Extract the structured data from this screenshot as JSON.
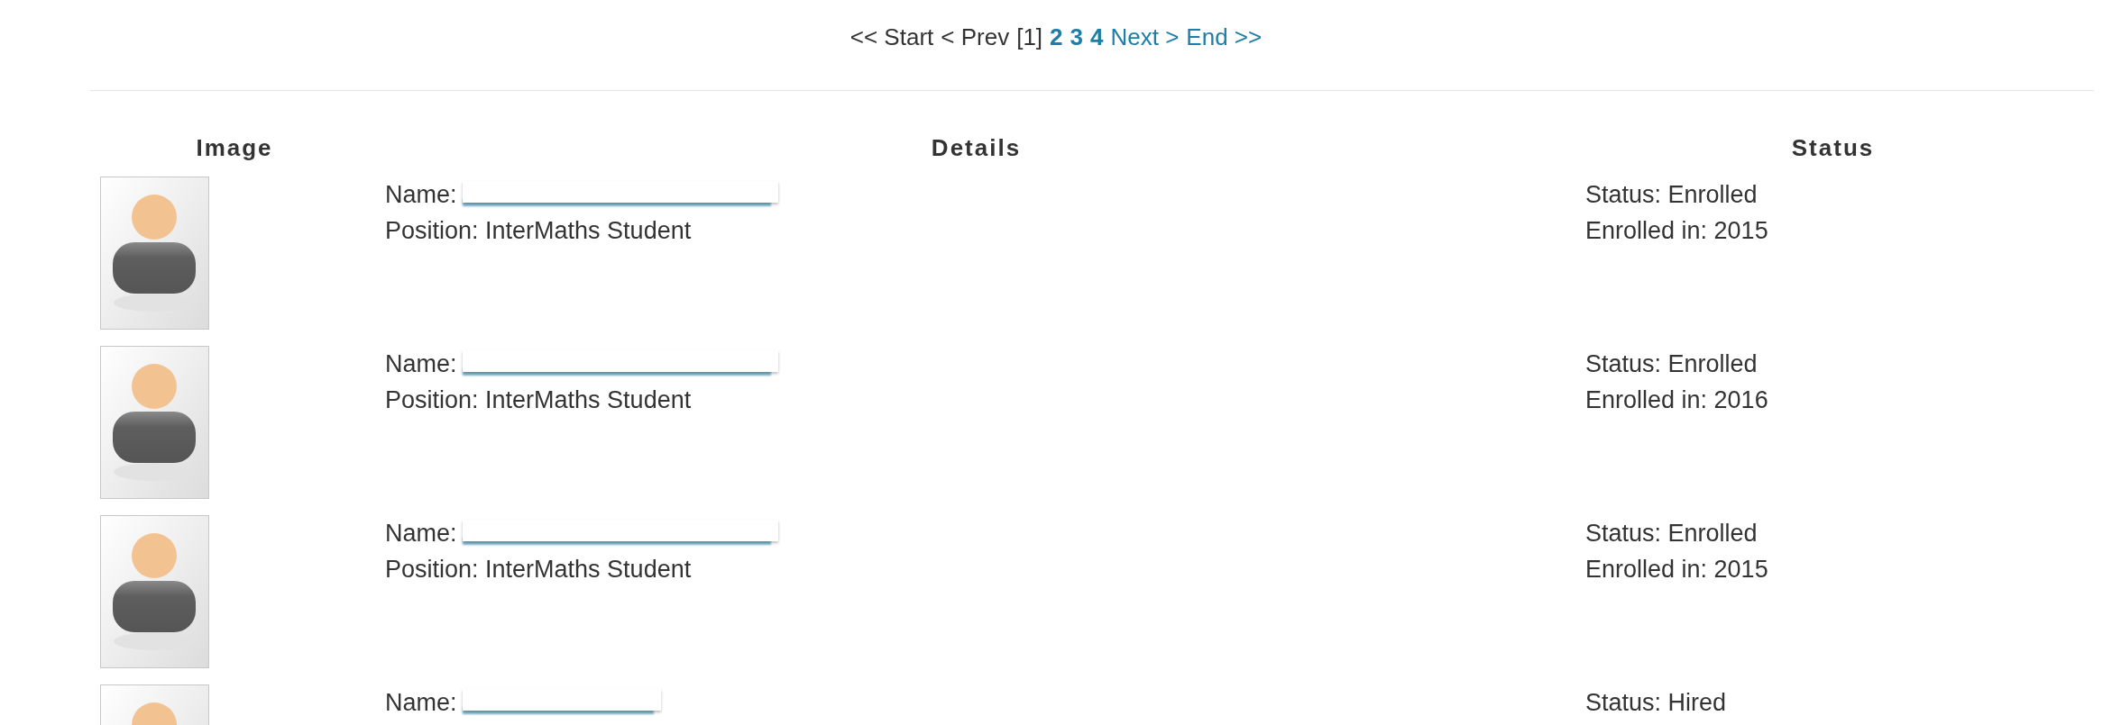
{
  "pagination": [
    {
      "label": "<< Start",
      "kind": "text"
    },
    {
      "label": "< Prev",
      "kind": "text"
    },
    {
      "label": "[1]",
      "kind": "page",
      "selected": true
    },
    {
      "label": "2",
      "kind": "page",
      "selected": false
    },
    {
      "label": "3",
      "kind": "page",
      "selected": false
    },
    {
      "label": "4",
      "kind": "page",
      "selected": false
    },
    {
      "label": "Next >",
      "kind": "link"
    },
    {
      "label": "End >>",
      "kind": "link"
    }
  ],
  "table": {
    "columns": [
      "Image",
      "Details",
      "Status"
    ],
    "rows": [
      {
        "name_label": "Name:",
        "position": "Position: InterMaths Student",
        "status": "Status: Enrolled",
        "enrolled": "Enrolled in: 2015"
      },
      {
        "name_label": "Name:",
        "position": "Position: InterMaths Student",
        "status": "Status: Enrolled",
        "enrolled": "Enrolled in: 2016"
      },
      {
        "name_label": "Name:",
        "position": "Position: InterMaths Student",
        "status": "Status: Enrolled",
        "enrolled": "Enrolled in: 2015"
      },
      {
        "name_label": "Name:",
        "status": "Status: Hired"
      }
    ]
  }
}
